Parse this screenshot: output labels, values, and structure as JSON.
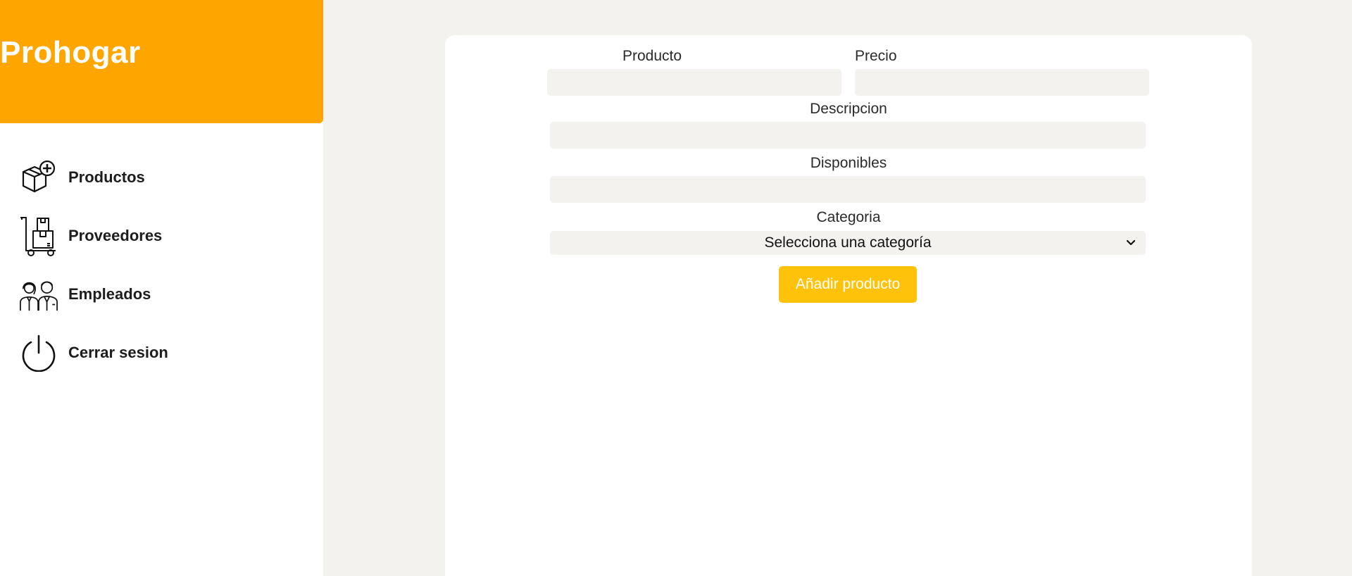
{
  "sidebar": {
    "brand": "Prohogar",
    "items": [
      {
        "label": "Productos",
        "icon": "box-add-icon"
      },
      {
        "label": "Proveedores",
        "icon": "hand-truck-icon"
      },
      {
        "label": "Empleados",
        "icon": "employees-icon"
      },
      {
        "label": "Cerrar sesion",
        "icon": "power-icon"
      }
    ]
  },
  "form": {
    "producto_label": "Producto",
    "producto_value": "",
    "precio_label": "Precio",
    "precio_value": "",
    "descripcion_label": "Descripcion",
    "descripcion_value": "",
    "disponibles_label": "Disponibles",
    "disponibles_value": "",
    "categoria_label": "Categoria",
    "categoria_selected": "Selecciona una categoría",
    "submit_label": "Añadir producto"
  },
  "colors": {
    "brand": "#ffa500",
    "button": "#ffc20a",
    "background": "#f3f2ef"
  }
}
